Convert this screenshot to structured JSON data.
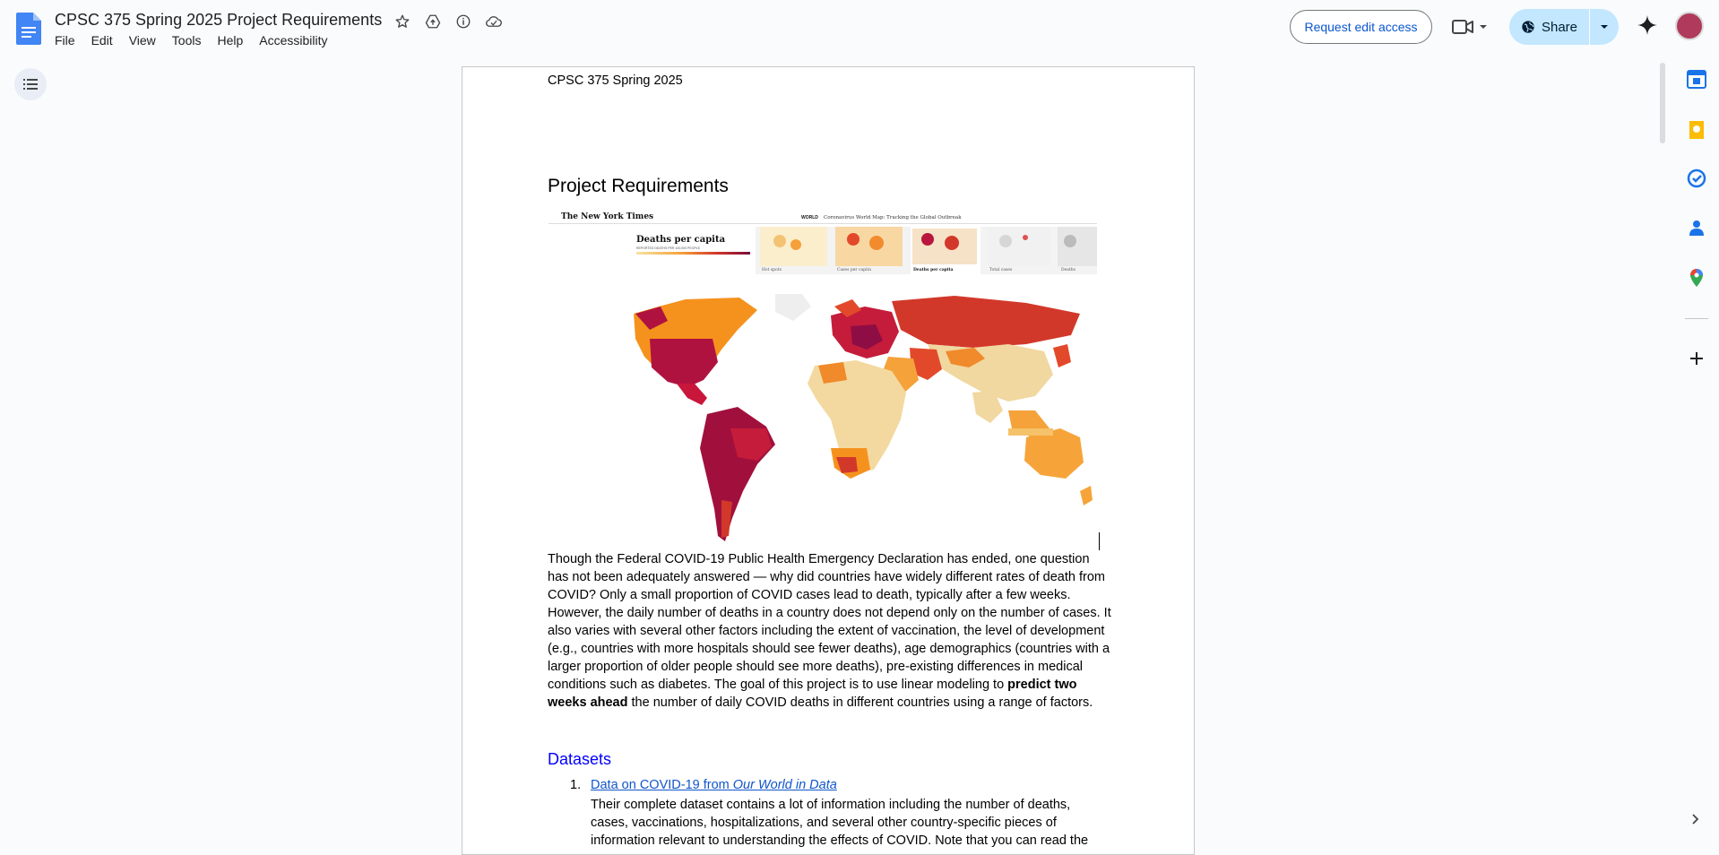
{
  "doc": {
    "title": "CPSC 375 Spring 2025 Project Requirements",
    "menu": [
      "File",
      "Edit",
      "View",
      "Tools",
      "Help",
      "Accessibility"
    ]
  },
  "toolbar": {
    "request_edit": "Request edit access",
    "share": "Share"
  },
  "page": {
    "header": "CPSC 375 Spring 2025",
    "heading": "Project Requirements",
    "image_nyt": {
      "masthead": "The New York Times",
      "section": "WORLD",
      "headline": "Coronavirus World Map: Tracking the Global Outbreak",
      "legend_title": "Deaths per capita",
      "legend_sub": "REPORTED DEATHS PER 100,000 PEOPLE",
      "tabs": [
        "Hot spots",
        "Cases per capita",
        "Deaths per capita",
        "Total cases",
        "Deaths"
      ]
    },
    "paragraph_pre": "Though the Federal COVID-19 Public Health Emergency Declaration has ended, one question has not been adequately answered — why did countries have widely different rates of death from COVID? Only a small proportion of COVID cases lead to death, typically after a few weeks. However, the daily number of deaths in a country does not depend only on the number of cases. It also varies with several other factors including the extent of vaccination, the level of development (e.g., countries with more hospitals should see fewer deaths), age demographics (countries with a larger proportion of older people should see more deaths), pre-existing differences in medical conditions such as diabetes. The goal of this project is to use linear modeling to ",
    "paragraph_bold": "predict two weeks ahead",
    "paragraph_post": " the number of daily COVID deaths in different countries using a range of factors.",
    "section_heading": "Datasets",
    "list": [
      {
        "number": "1.",
        "link_pre": "Data on COVID-19 from ",
        "link_italic": "Our World in Data",
        "body": "Their complete dataset contains a lot of information including the number of deaths, cases, vaccinations, hospitalizations, and several other country-specific pieces of information relevant to understanding the effects of COVID. Note that you can read the"
      }
    ]
  },
  "colors": {
    "accent": "#0b57d0",
    "share_bg": "#c2e7ff",
    "heading_blue": "#0000ff",
    "link": "#1155cc"
  },
  "icons": [
    "docs-logo-icon",
    "star-icon",
    "move-to-drive-icon",
    "info-icon",
    "cloud-status-icon",
    "meet-icon",
    "globe-icon",
    "chevron-down-icon",
    "gemini-icon",
    "outline-icon",
    "calendar-icon",
    "keep-icon",
    "tasks-icon",
    "contacts-icon",
    "maps-icon",
    "plus-icon",
    "chevron-right-icon"
  ]
}
